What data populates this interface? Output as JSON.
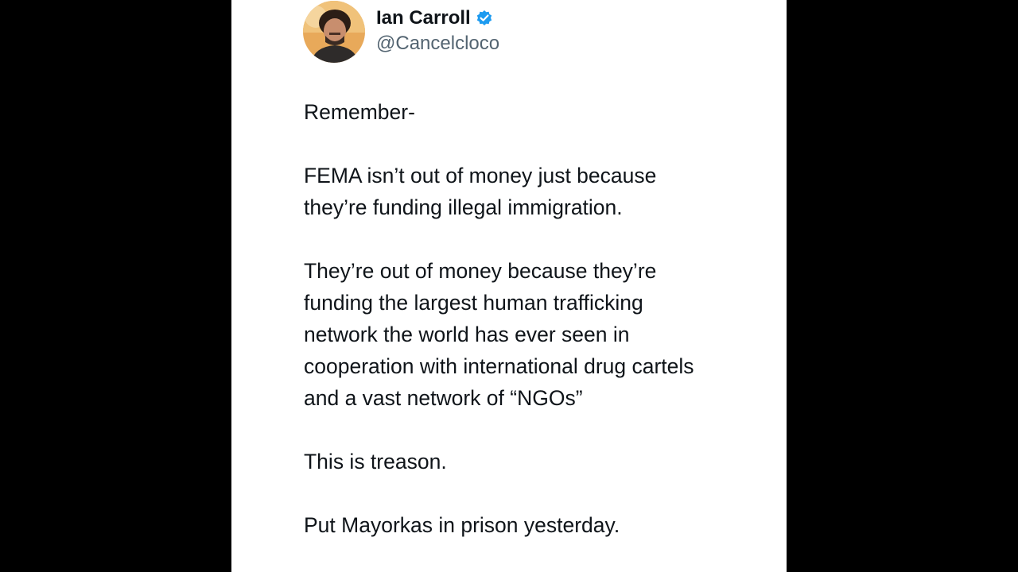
{
  "author": {
    "display_name": "Ian Carroll",
    "handle": "@Cancelcloco",
    "verified": true,
    "verified_color": "#1d9bf0",
    "avatar_icon": "profile-photo"
  },
  "tweet": {
    "paragraphs": [
      "Remember-",
      "FEMA isn’t out of money just because\nthey’re funding illegal immigration.",
      "They’re out of money because they’re\nfunding the largest human trafficking\nnetwork the world has ever seen in\ncooperation with international drug cartels\nand a vast network of “NGOs”",
      "This is treason.",
      "Put Mayorkas in prison yesterday."
    ]
  },
  "colors": {
    "background": "#000000",
    "card": "#ffffff",
    "text": "#0f1419",
    "handle": "#536471"
  }
}
